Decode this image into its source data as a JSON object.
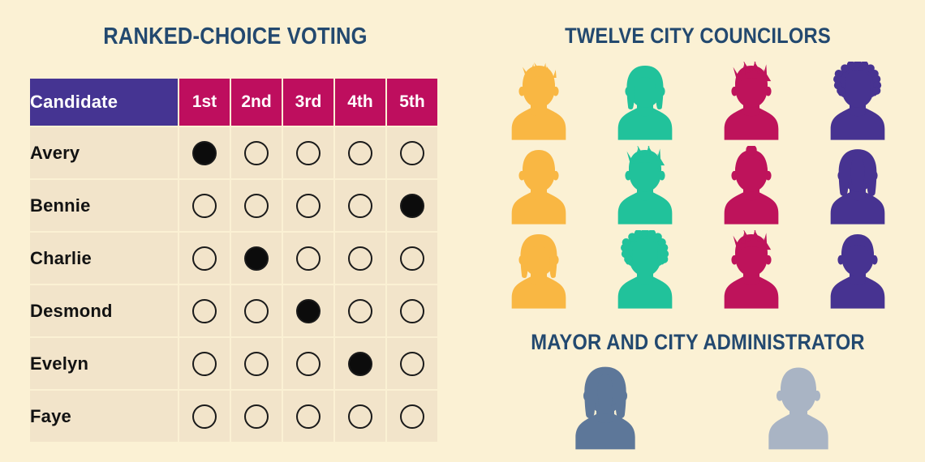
{
  "theme": {
    "background": "#fbf1d4",
    "title_color": "#23496f",
    "header_purple": "#453492",
    "header_crimson": "#be0e5e",
    "row_background": "#f2e4ca",
    "bubble_outline": "#1a1a1a",
    "bubble_fill": "#0c0c0c"
  },
  "left": {
    "title": "RANKED-CHOICE VOTING",
    "table": {
      "columns": [
        "Candidate",
        "1st",
        "2nd",
        "3rd",
        "4th",
        "5th"
      ],
      "rows": [
        {
          "candidate": "Avery",
          "marks": [
            true,
            false,
            false,
            false,
            false
          ]
        },
        {
          "candidate": "Bennie",
          "marks": [
            false,
            false,
            false,
            false,
            true
          ]
        },
        {
          "candidate": "Charlie",
          "marks": [
            false,
            true,
            false,
            false,
            false
          ]
        },
        {
          "candidate": "Desmond",
          "marks": [
            false,
            false,
            true,
            false,
            false
          ]
        },
        {
          "candidate": "Evelyn",
          "marks": [
            false,
            false,
            false,
            true,
            false
          ]
        },
        {
          "candidate": "Faye",
          "marks": [
            false,
            false,
            false,
            false,
            false
          ]
        }
      ]
    }
  },
  "right": {
    "councilors_title": "TWELVE CITY COUNCILORS",
    "councilors_count": 12,
    "councilors": [
      {
        "name": "councilor-1",
        "color": "#f9b743",
        "hair": "short-tousled"
      },
      {
        "name": "councilor-2",
        "color": "#21c29b",
        "hair": "bob"
      },
      {
        "name": "councilor-3",
        "color": "#be135b",
        "hair": "spiky"
      },
      {
        "name": "councilor-4",
        "color": "#473391",
        "hair": "afro"
      },
      {
        "name": "councilor-5",
        "color": "#f9b743",
        "hair": "plain"
      },
      {
        "name": "councilor-6",
        "color": "#21c29b",
        "hair": "spiky"
      },
      {
        "name": "councilor-7",
        "color": "#be135b",
        "hair": "bun"
      },
      {
        "name": "councilor-8",
        "color": "#473391",
        "hair": "long"
      },
      {
        "name": "councilor-9",
        "color": "#f9b743",
        "hair": "bob"
      },
      {
        "name": "councilor-10",
        "color": "#21c29b",
        "hair": "afro"
      },
      {
        "name": "councilor-11",
        "color": "#be135b",
        "hair": "spiky"
      },
      {
        "name": "councilor-12",
        "color": "#473391",
        "hair": "plain"
      }
    ],
    "mayor_title": "MAYOR AND CITY ADMINISTRATOR",
    "leaders": [
      {
        "name": "mayor",
        "color": "#5d7799",
        "hair": "long"
      },
      {
        "name": "city-administrator",
        "color": "#a9b4c4",
        "hair": "plain"
      }
    ]
  }
}
